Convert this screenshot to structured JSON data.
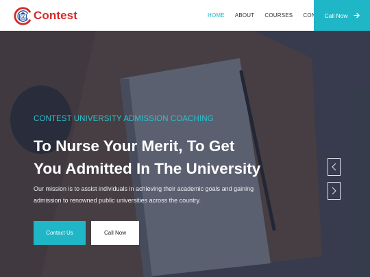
{
  "brand": {
    "name": "Contest",
    "logo_icon": "cc-badge-logo"
  },
  "nav": {
    "links": [
      {
        "label": "HOME",
        "active": true
      },
      {
        "label": "ABOUT",
        "active": false
      },
      {
        "label": "COURSES",
        "active": false
      },
      {
        "label": "CONTACT",
        "active": false
      }
    ],
    "call_now": {
      "label": "Call Now",
      "icon": "arrow-right-icon"
    }
  },
  "hero": {
    "eyebrow": "CONTEST UNIVERSITY ADMISSION COACHING",
    "headline": "To Nurse Your Merit, To Get You Admitted In The University",
    "subtext": "Our mission is to assist individuals in achieving their academic goals and gaining admission to renowned public universities across the country.",
    "buttons": {
      "contact": "Contact Us",
      "call": "Call Now"
    },
    "slider": {
      "prev_icon": "chevron-left-icon",
      "next_icon": "chevron-right-icon"
    }
  },
  "colors": {
    "brand_red": "#d62828",
    "accent_teal": "#1fb6c7",
    "eyebrow_teal": "#2ec0d0",
    "logo_blue": "#1d4e9e",
    "hero_overlay": "#282c3e"
  }
}
